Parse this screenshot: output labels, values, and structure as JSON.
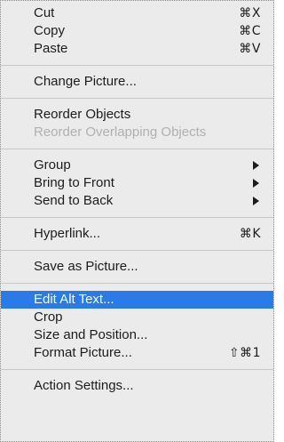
{
  "menu": {
    "groups": [
      {
        "items": [
          {
            "label": "Cut",
            "shortcut": "⌘X"
          },
          {
            "label": "Copy",
            "shortcut": "⌘C"
          },
          {
            "label": "Paste",
            "shortcut": "⌘V"
          }
        ]
      },
      {
        "items": [
          {
            "label": "Change Picture..."
          }
        ]
      },
      {
        "items": [
          {
            "label": "Reorder Objects"
          },
          {
            "label": "Reorder Overlapping Objects",
            "disabled": true
          }
        ]
      },
      {
        "items": [
          {
            "label": "Group",
            "submenu": true
          },
          {
            "label": "Bring to Front",
            "submenu": true
          },
          {
            "label": "Send to Back",
            "submenu": true
          }
        ]
      },
      {
        "items": [
          {
            "label": "Hyperlink...",
            "shortcut": "⌘K"
          }
        ]
      },
      {
        "items": [
          {
            "label": "Save as Picture..."
          }
        ]
      },
      {
        "items": [
          {
            "label": "Edit Alt Text...",
            "highlighted": true
          },
          {
            "label": "Crop"
          },
          {
            "label": "Size and Position..."
          },
          {
            "label": "Format Picture...",
            "shortcut": "⇧⌘1"
          }
        ]
      },
      {
        "items": [
          {
            "label": "Action Settings..."
          }
        ]
      }
    ]
  },
  "colors": {
    "menu_background": "#ebebeb",
    "highlight": "#2a7ae8",
    "disabled_text": "#b0b0b0",
    "separator": "#c8c8c8"
  },
  "icons": {
    "submenu": "submenu-arrow-icon"
  }
}
